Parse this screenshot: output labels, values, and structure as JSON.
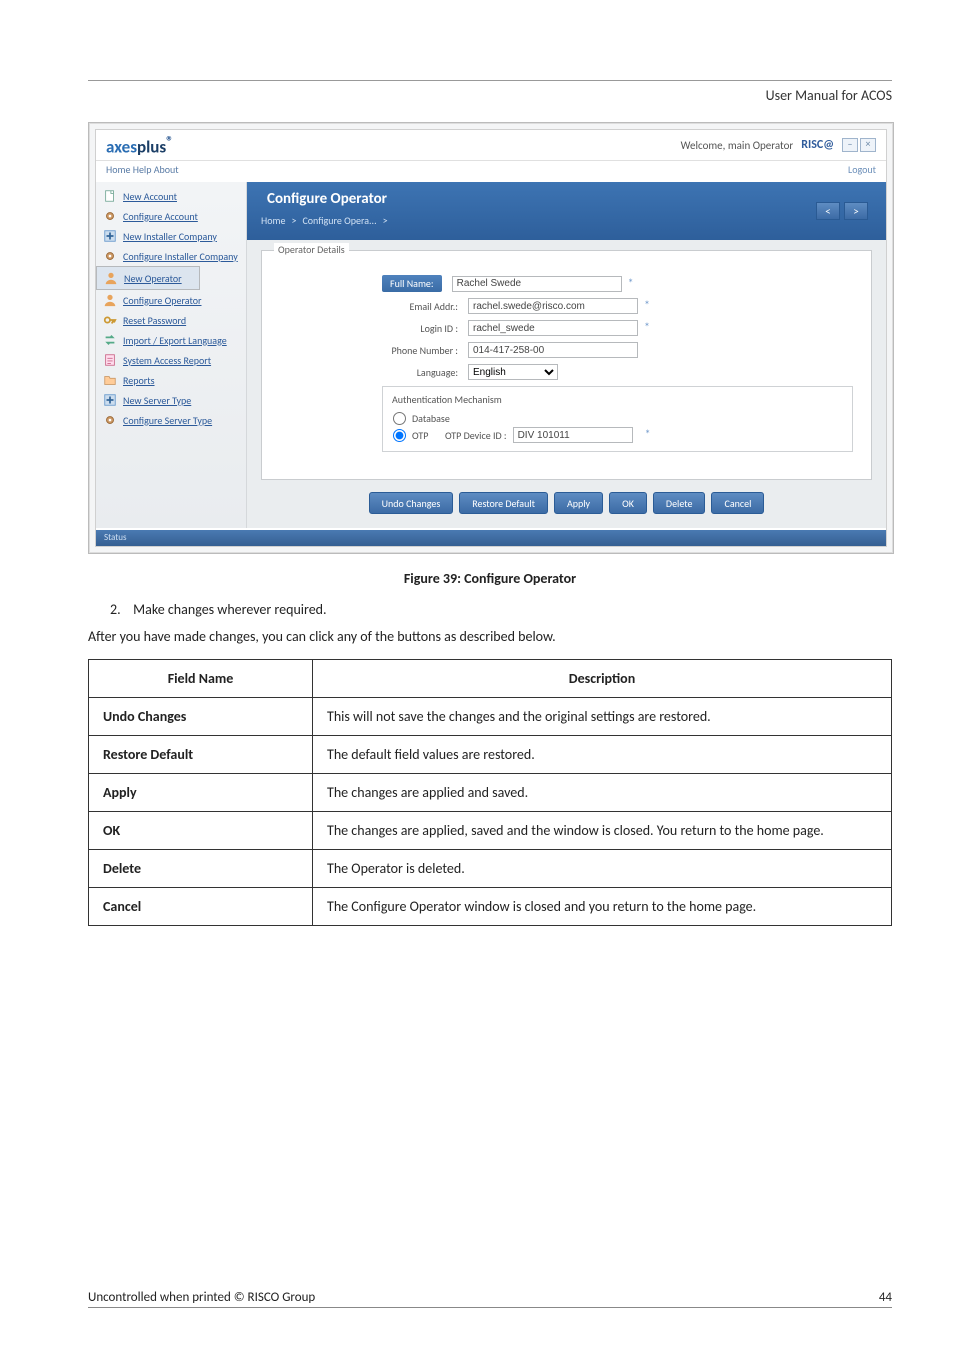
{
  "doc": {
    "header_title": "User Manual for ACOS",
    "caption": "Figure 39: Configure Operator",
    "step_num": "2.",
    "step_text": "Make changes wherever required.",
    "after_text": "After you have made changes, you can click any of the buttons as described below.",
    "footer_left": "Uncontrolled when printed © RISCO Group",
    "footer_right": "44"
  },
  "table": {
    "head_field": "Field Name",
    "head_desc": "Description",
    "rows": [
      {
        "f": "Undo Changes",
        "d": "This will not save the changes and the original settings are restored."
      },
      {
        "f": "Restore Default",
        "d": "The default field values are restored."
      },
      {
        "f": "Apply",
        "d": "The changes are applied and saved."
      },
      {
        "f": "OK",
        "d": "The changes are applied, saved and the window is closed. You return to the home page."
      },
      {
        "f": "Delete",
        "d": "The Operator is deleted."
      },
      {
        "f": "Cancel",
        "d": "The Configure Operator window is closed and you return to the home page."
      }
    ]
  },
  "app": {
    "brand_a": "axes",
    "brand_b": "plus",
    "brand_tm": "®",
    "welcome": "Welcome, main Operator",
    "risco": "RISC@",
    "menu": "Home   Help   About",
    "logout": "Logout",
    "status": "Status",
    "bluebar_title": "Configure Operator",
    "crumb_home": "Home",
    "crumb_sep": ">",
    "crumb_cur": "Configure Opera...",
    "pager_prev": "<",
    "pager_next": ">",
    "panel_title": "Operator Details",
    "labels": {
      "fullname": "Full Name:",
      "email": "Email Addr.:",
      "login": "Login ID :",
      "phone": "Phone Number :",
      "language": "Language:",
      "auth": "Authentication Mechanism",
      "db": "Database",
      "otp": "OTP",
      "otp_device": "OTP Device ID :"
    },
    "values": {
      "fullname": "Rachel Swede",
      "email": "rachel.swede@risco.com",
      "login": "rachel_swede",
      "phone": "014-417-258-00",
      "language": "English",
      "otp_device": "DIV 101011"
    },
    "buttons": {
      "undo": "Undo Changes",
      "restore": "Restore Default",
      "apply": "Apply",
      "ok": "OK",
      "delete": "Delete",
      "cancel": "Cancel"
    },
    "sidebar": [
      {
        "label": "New Account",
        "ico": "doc"
      },
      {
        "label": "Configure Account",
        "ico": "gear"
      },
      {
        "label": "New Installer Company",
        "ico": "plus"
      },
      {
        "label": "Configure Installer Company",
        "ico": "gear"
      },
      {
        "label": "New Operator",
        "ico": "user",
        "sel": true
      },
      {
        "label": "Configure Operator",
        "ico": "user"
      },
      {
        "label": "Reset Password",
        "ico": "key"
      },
      {
        "label": "Import / Export Language",
        "ico": "arrows"
      },
      {
        "label": "System Access Report",
        "ico": "report"
      },
      {
        "label": "Reports",
        "ico": "folder"
      },
      {
        "label": "New Server Type",
        "ico": "plus"
      },
      {
        "label": "Configure Server Type",
        "ico": "gear"
      }
    ]
  }
}
